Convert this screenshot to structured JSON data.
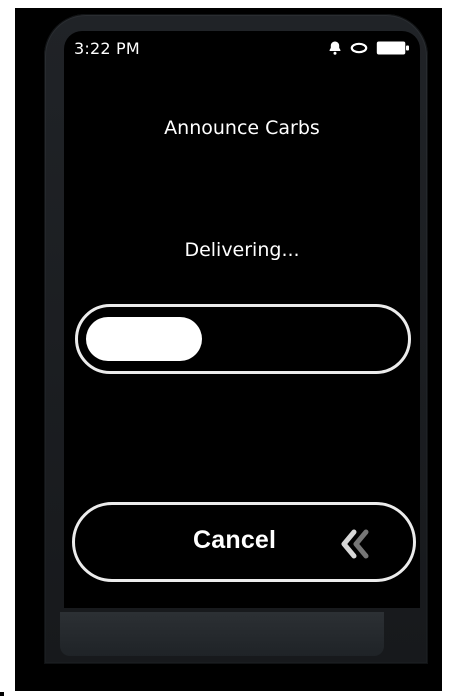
{
  "status_bar": {
    "time": "3:22 PM",
    "icons": [
      "bell-icon",
      "pod-icon",
      "battery-icon"
    ]
  },
  "screen": {
    "title": "Announce Carbs",
    "status_text": "Delivering...",
    "progress": 0.37
  },
  "actions": {
    "cancel_label": "Cancel",
    "cancel_icon": "double-chevron-left-icon"
  },
  "colors": {
    "background": "#000000",
    "text": "#ffffff",
    "outline": "#ececec"
  }
}
